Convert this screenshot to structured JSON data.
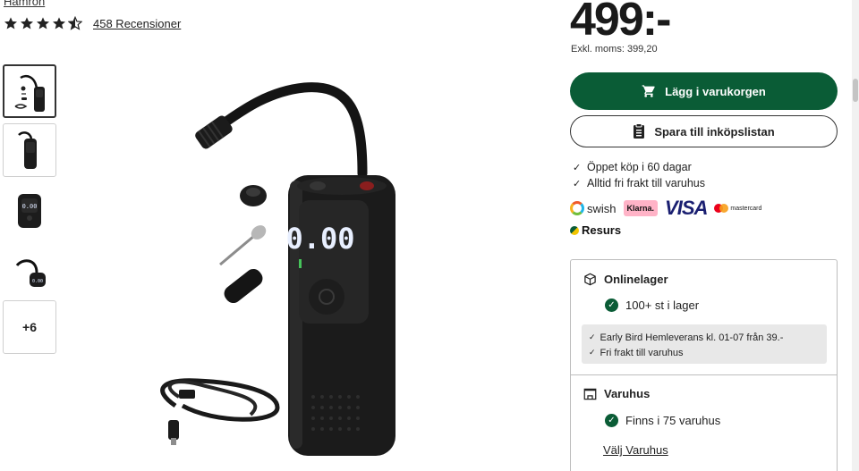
{
  "product": {
    "brand": "Hamron",
    "rating_value": 4.5,
    "reviews_label": "458 Recensioner"
  },
  "gallery": {
    "more_label": "+6",
    "thumbnails": [
      "pump-front-thumb",
      "pump-side-thumb",
      "pump-display-thumb",
      "pump-hose-thumb"
    ]
  },
  "pricing": {
    "price": "499:-",
    "ex_vat": "Exkl. moms: 399,20"
  },
  "actions": {
    "add_to_cart": "Lägg i varukorgen",
    "save_list": "Spara till inköpslistan"
  },
  "perks": [
    "Öppet köp i 60 dagar",
    "Alltid fri frakt till varuhus"
  ],
  "payments": {
    "swish": "swish",
    "klarna": "Klarna.",
    "visa": "VISA",
    "mastercard": "mastercard",
    "resurs": "Resurs"
  },
  "stock": {
    "online_title": "Onlinelager",
    "online_status": "100+ st i lager",
    "delivery_lines": [
      "Early Bird Hemleverans kl. 01-07 från 39.-",
      "Fri frakt till varuhus"
    ],
    "store_title": "Varuhus",
    "store_status": "Finns i 75 varuhus",
    "choose_store": "Välj Varuhus"
  },
  "colors": {
    "brand_green": "#0a5c36",
    "star": "#222222"
  }
}
